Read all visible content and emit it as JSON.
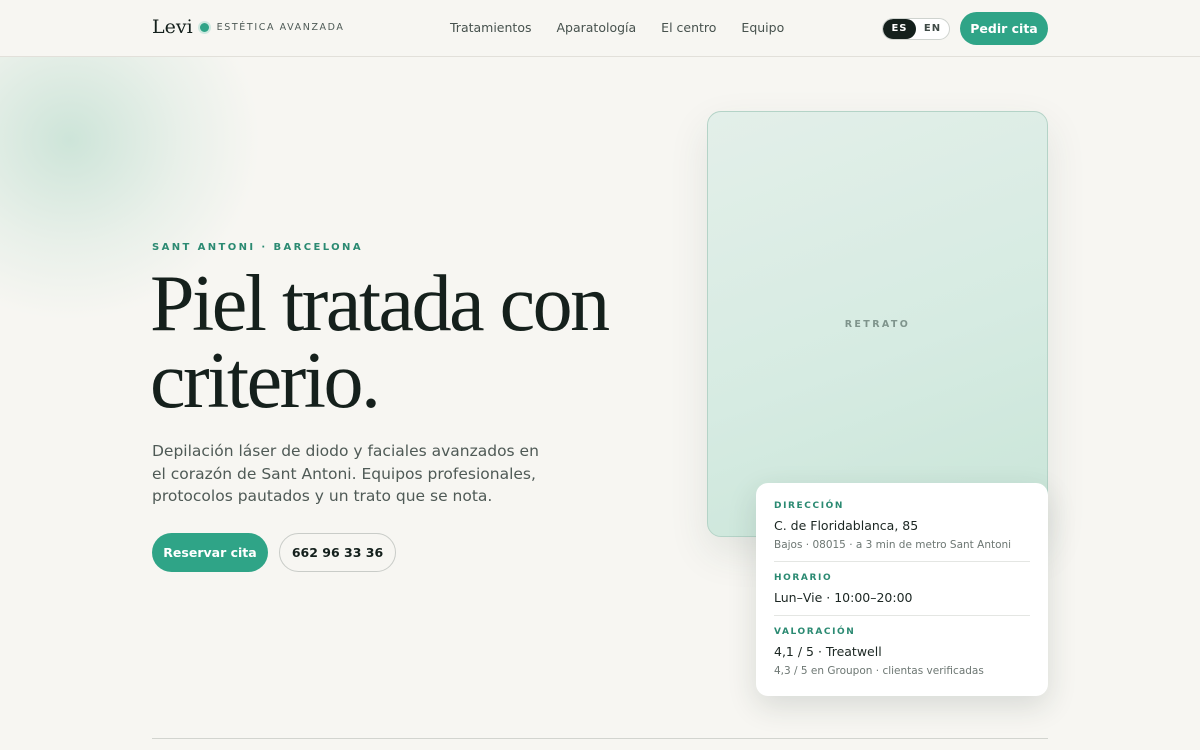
{
  "brand": {
    "name": "Levi",
    "tagline": "ESTÉTICA AVANZADA",
    "accent": "#2fa487"
  },
  "nav": {
    "items": [
      "Tratamientos",
      "Aparatología",
      "El centro",
      "Equipo"
    ]
  },
  "lang": {
    "es": "ES",
    "en": "EN",
    "active": "ES"
  },
  "header": {
    "cta": "Pedir cita"
  },
  "hero": {
    "eyebrow": "SANT ANTONI · BARCELONA",
    "title_line1": "Piel tratada con",
    "title_line2": "criterio.",
    "lead": "Depilación láser de diodo y faciales avanzados en el corazón de Sant Antoni. Equipos profesionales, protocolos pautados y un trato que se nota.",
    "primary_cta": "Reservar cita",
    "phone": "662 96 33 36"
  },
  "portrait": {
    "label": "RETRATO"
  },
  "info": {
    "address": {
      "label": "DIRECCIÓN",
      "main": "C. de Floridablanca, 85",
      "sub": "Bajos · 08015 · a 3 min de metro Sant Antoni"
    },
    "hours": {
      "label": "HORARIO",
      "main": "Lun–Vie · 10:00–20:00"
    },
    "rating": {
      "label": "VALORACIÓN",
      "main": "4,1 / 5 · Treatwell",
      "sub": "4,3 / 5 en Groupon · clientas verificadas"
    }
  }
}
